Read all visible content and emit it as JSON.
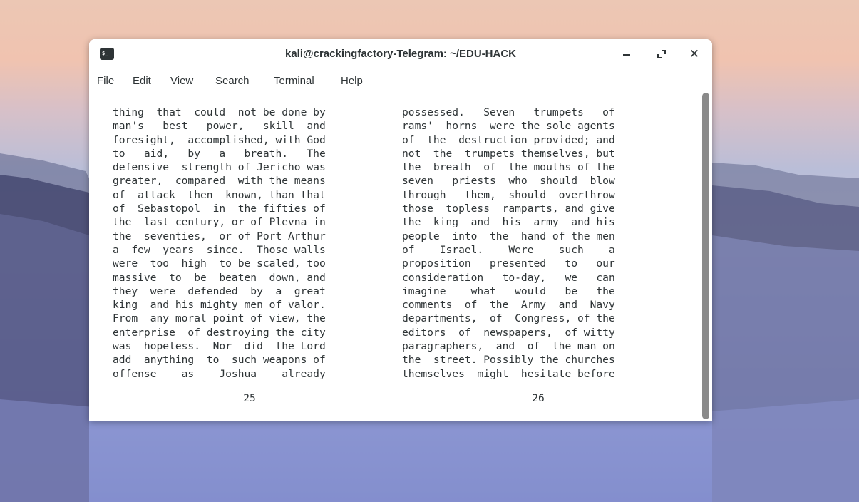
{
  "window": {
    "title": "kali@crackingfactory-Telegram: ~/EDU-HACK",
    "icon": "terminal-icon",
    "icon_glyph": "$_",
    "minimize_icon": "minimize-icon",
    "maximize_icon": "maximize-icon",
    "close_icon": "close-icon",
    "close_glyph": "✕"
  },
  "menu": [
    "File",
    "Edit",
    "View",
    "Search",
    "Terminal",
    "Help"
  ],
  "pages": {
    "left": {
      "lines": [
        "thing  that  could  not be done by",
        "man's   best   power,   skill  and",
        "foresight,  accomplished, with God",
        "to   aid,   by   a   breath.   The",
        "defensive  strength of Jericho was",
        "greater,  compared  with the means",
        "of  attack  then  known, than that",
        "of  Sebastopol  in  the fifties of",
        "the  last century, or of Plevna in",
        "the  seventies,  or of Port Arthur",
        "a  few  years  since.  Those walls",
        "were  too  high  to be scaled, too",
        "massive  to  be  beaten  down, and",
        "they  were  defended  by  a  great",
        "king  and his mighty men of valor.",
        "From  any moral point of view, the",
        "enterprise  of destroying the city",
        "was  hopeless.  Nor  did  the Lord",
        "add  anything  to  such weapons of",
        "offense    as    Joshua    already"
      ],
      "page_number": "25"
    },
    "right": {
      "lines": [
        "possessed.   Seven   trumpets   of",
        "rams'  horns  were the sole agents",
        "of  the  destruction provided; and",
        "not  the  trumpets themselves, but",
        "the  breath  of  the mouths of the",
        "seven   priests  who  should  blow",
        "through   them,  should  overthrow",
        "those  topless  ramparts, and give",
        "the  king  and  his  army  and his",
        "people  into  the  hand of the men",
        "of    Israel.    Were    such    a",
        "proposition   presented   to   our",
        "consideration   to-day,   we   can",
        "imagine    what   would   be   the",
        "comments  of  the  Army  and  Navy",
        "departments,  of  Congress, of the",
        "editors  of  newspapers,  of witty",
        "paragraphers,  and  of  the man on",
        "the  street. Possibly the churches",
        "themselves  might  hesitate before"
      ],
      "page_number": "26"
    }
  }
}
